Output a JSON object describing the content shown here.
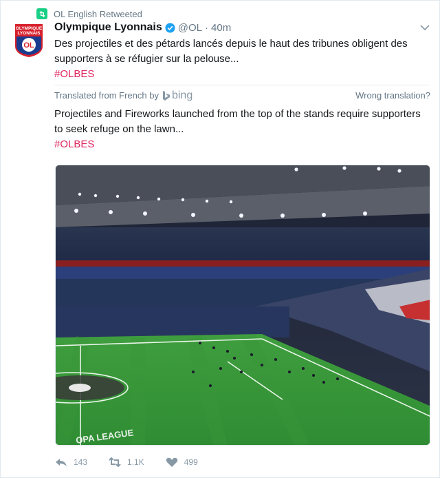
{
  "retweet_context": {
    "label": "OL English Retweeted"
  },
  "author": {
    "display_name": "Olympique Lyonnais",
    "handle": "@OL",
    "separator": "·",
    "time": "40m",
    "avatar_text_line1": "OLYMPIQUE",
    "avatar_text_line2": "LYONNAIS",
    "avatar_monogram": "OL"
  },
  "tweet": {
    "text": "Des projectiles et des pétards lancés depuis le haut des tribunes obligent des supporters à se réfugier sur la pelouse...",
    "hashtag": "#OLBES"
  },
  "translation": {
    "translated_from": "Translated from French by",
    "provider": "bing",
    "wrong_translation": "Wrong translation?",
    "text": "Projectiles and Fireworks launched from the top of the stands require supporters to seek refuge on the lawn...",
    "hashtag": "#OLBES"
  },
  "media": {
    "pitch_text": "OPA LEAGUE",
    "colors": {
      "pitch": "#3a9c3a",
      "stands": "#23304f",
      "roof": "#4a4e58"
    }
  },
  "actions": {
    "reply_count": "143",
    "retweet_count": "1.1K",
    "like_count": "499"
  },
  "colors": {
    "retweet_badge": "#19cf86",
    "hashtag": "#e0245e",
    "verified": "#1da1f2",
    "muted": "#657786"
  }
}
